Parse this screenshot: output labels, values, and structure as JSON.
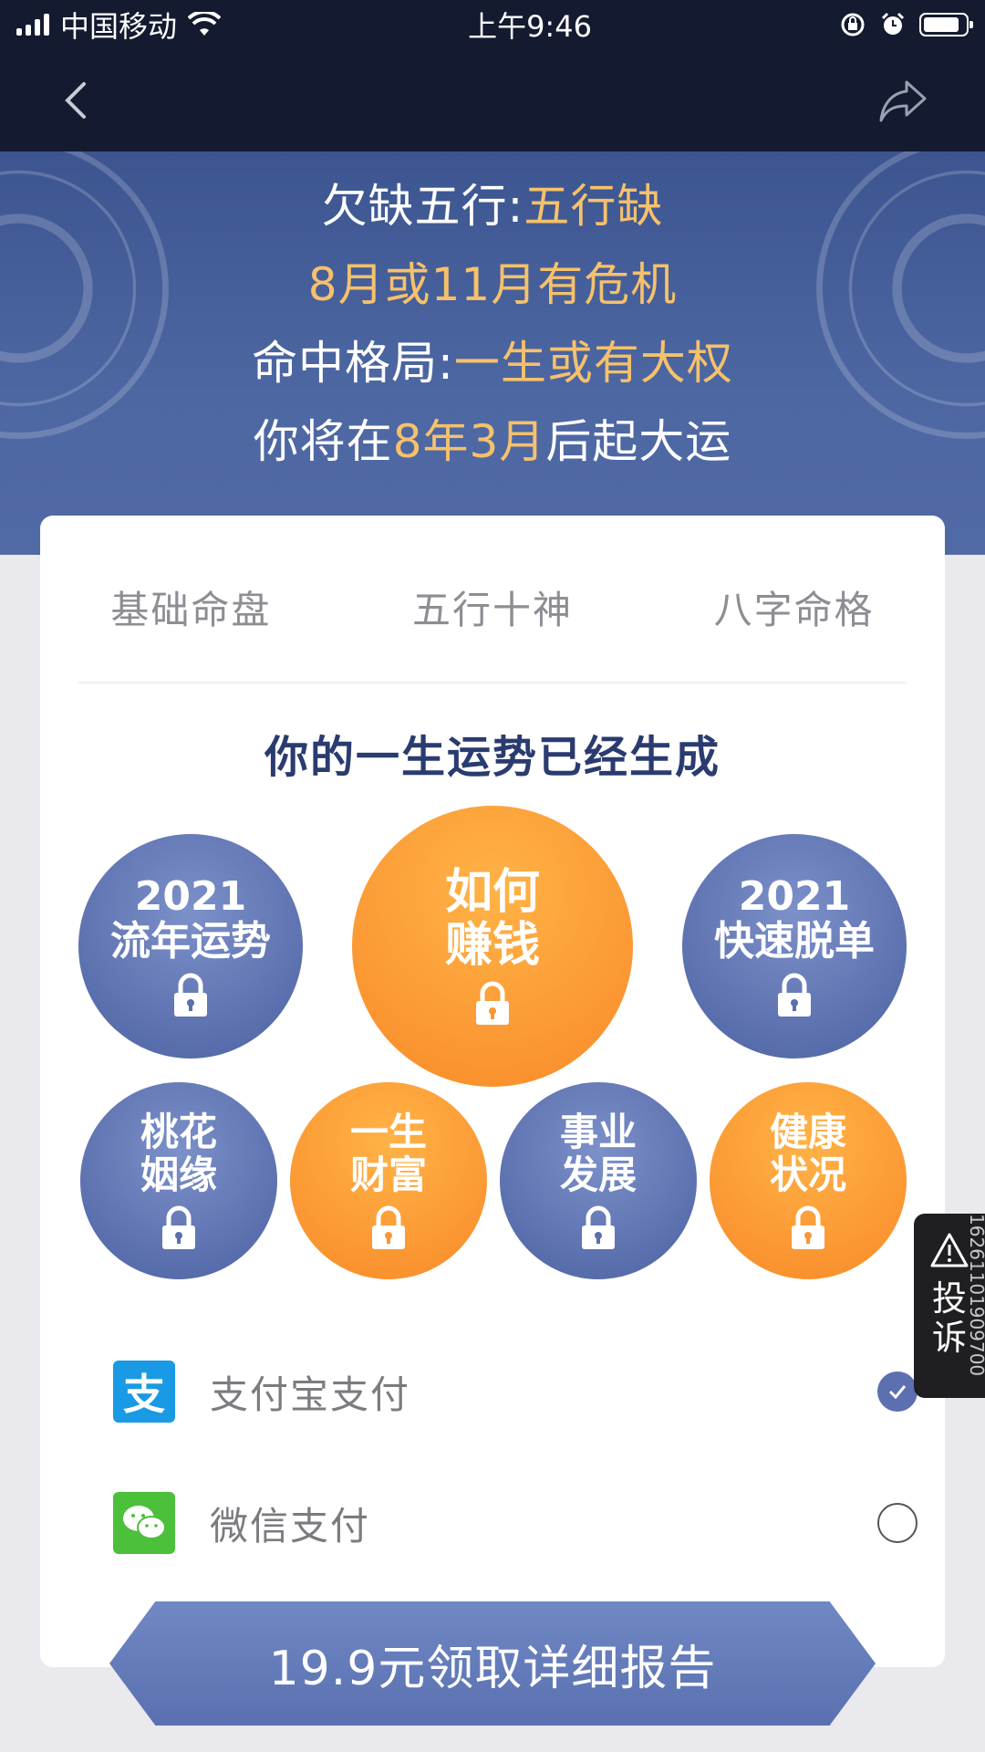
{
  "status_bar": {
    "carrier": "中国移动",
    "time": "上午9:46"
  },
  "banner": {
    "line1_prefix": "欠缺五行:",
    "line1_value": "五行缺",
    "line2": "8月或11月有危机",
    "line3_prefix": "命中格局:",
    "line3_value": "一生或有大权",
    "line4_prefix": "你将在",
    "line4_value": "8年3月",
    "line4_suffix": "后起大运"
  },
  "tabs": [
    "基础命盘",
    "五行十神",
    "八字命格"
  ],
  "headline": "你的一生运势已经生成",
  "bubbles": {
    "b1": {
      "line1": "2021",
      "line2": "流年运势"
    },
    "b2": {
      "line1": "如何",
      "line2": "赚钱"
    },
    "b3": {
      "line1": "2021",
      "line2": "快速脱单"
    },
    "b4": {
      "line1": "桃花",
      "line2": "姻缘"
    },
    "b5": {
      "line1": "一生",
      "line2": "财富"
    },
    "b6": {
      "line1": "事业",
      "line2": "发展"
    },
    "b7": {
      "line1": "健康",
      "line2": "状况"
    }
  },
  "payment": {
    "alipay_label": "支付宝支付",
    "alipay_icon_char": "支",
    "wechat_label": "微信支付",
    "selected": "alipay"
  },
  "cta_label": "19.9元领取详细报告",
  "complaint": {
    "label": "投诉",
    "code": "16261101909700"
  },
  "colors": {
    "nav_bg": "#141a2f",
    "banner_bg": "#4d67a3",
    "highlight": "#f6c16b",
    "bubble_blue": "#5a6fad",
    "bubble_orange": "#fb9632",
    "headline": "#2a3b70"
  },
  "icons": {
    "back": "chevron-left-icon",
    "share": "share-icon",
    "lock": "lock-icon",
    "alipay": "alipay-icon",
    "wechat": "wechat-icon",
    "check": "check-icon",
    "warning": "warning-triangle-icon"
  }
}
